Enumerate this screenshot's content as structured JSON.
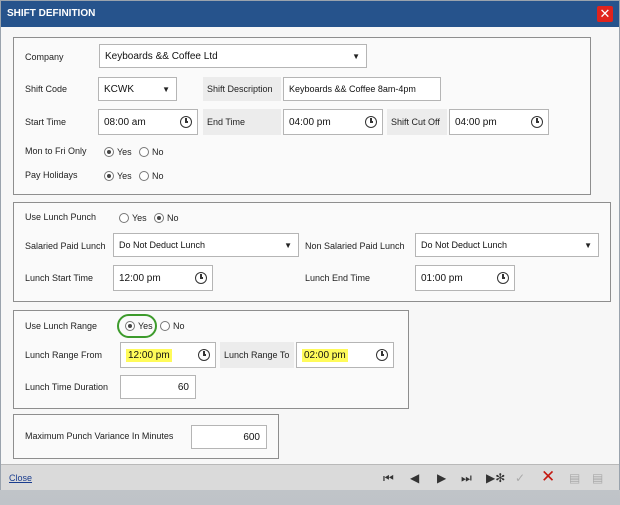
{
  "dialog": {
    "title": "SHIFT DEFINITION",
    "close_glyph": "✕"
  },
  "shift": {
    "company_label": "Company",
    "company_value": "Keyboards && Coffee Ltd",
    "shift_code_label": "Shift Code",
    "shift_code_value": "KCWK",
    "shift_description_label": "Shift Description",
    "shift_description_value": "Keyboards && Coffee 8am-4pm",
    "start_time_label": "Start Time",
    "start_time_value": "08:00 am",
    "end_time_label": "End Time",
    "end_time_value": "04:00 pm",
    "shift_cutoff_label": "Shift Cut Off",
    "shift_cutoff_value": "04:00 pm",
    "mon_fri_label": "Mon to Fri Only",
    "mon_fri_yes": "Yes",
    "mon_fri_no": "No",
    "pay_holidays_label": "Pay Holidays",
    "pay_holidays_yes": "Yes",
    "pay_holidays_no": "No"
  },
  "lunch": {
    "use_lunch_punch_label": "Use Lunch Punch",
    "yes": "Yes",
    "no": "No",
    "salaried_label": "Salaried Paid Lunch",
    "salaried_value": "Do Not Deduct Lunch",
    "non_salaried_label": "Non Salaried Paid Lunch",
    "non_salaried_value": "Do Not Deduct Lunch",
    "start_label": "Lunch Start Time",
    "start_value": "12:00 pm",
    "end_label": "Lunch End Time",
    "end_value": "01:00 pm"
  },
  "range": {
    "use_label": "Use Lunch Range",
    "yes": "Yes",
    "no": "No",
    "from_label": "Lunch Range From",
    "from_value": "12:00 pm",
    "to_label": "Lunch Range To",
    "to_value": "02:00 pm",
    "duration_label": "Lunch Time Duration",
    "duration_value": "60"
  },
  "variance": {
    "label": "Maximum Punch Variance In Minutes",
    "value": "600"
  },
  "footer": {
    "close_label": "Close",
    "first": "⏮",
    "prev": "◀",
    "next": "▶",
    "last": "⏭",
    "new": "▶✻",
    "confirm": "✓",
    "cancel": "✕",
    "save": "▤",
    "save_edit": "▤"
  }
}
